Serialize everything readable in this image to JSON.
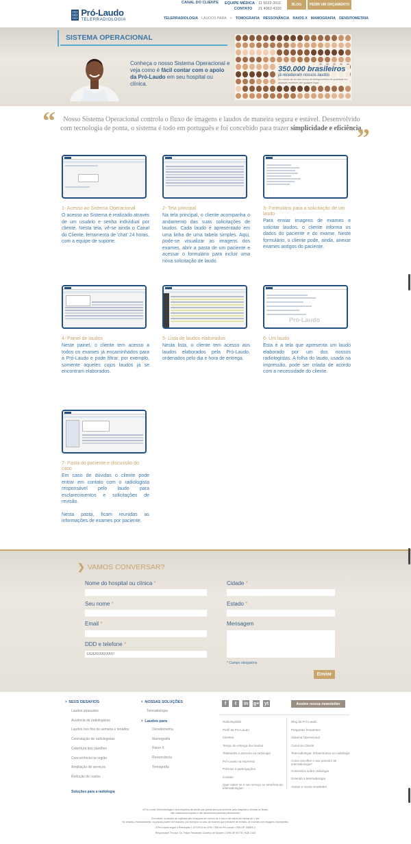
{
  "header": {
    "logo_name": "Pró-Laudo",
    "logo_sub": "TELERRADIOLOGIA",
    "canal_cliente": "CANAL DO CLIENTE",
    "equipe_medica": "EQUIPE MÉDICA",
    "contato": "CONTATO",
    "phone1": "11 5022-3011",
    "phone2": "21 4063 4100",
    "blog": "BLOG",
    "pedir_orcamento": "PEDIR UM ORÇAMENTO",
    "nav": [
      "TELERRADIOLOGIA",
      "LAUDOS PARA",
      "TOMOGRAFIA",
      "RESSONÂNCIA",
      "RAIOS X",
      "MAMOGRAFIA",
      "DENSITOMETRIA"
    ],
    "nav_sep": ">"
  },
  "banner": {
    "title": "SISTEMA OPERACIONAL",
    "text_pre": "Conheça o nosso Sistema Operacional e veja como é ",
    "text_bold": "fácil contar com o apoio da Pró-Laudo",
    "text_post": " em seu hospital ou clínica.",
    "ad_number": "350.000 brasileiros",
    "ad_sub": "já receberam nossos laudos",
    "ad_small": "Em menos de um ano fomos de entrega médica de qualidade em qualquer momento, em qualquer lugar."
  },
  "quote": {
    "text": "Nosso Sistema Operacional controla o fluxo de imagens e laudos de maneira segura e estável. Desenvolvido com tecnologia de ponta, o sistema é todo em português e foi concebido para trazer ",
    "bold": "simplicidade e eficiência",
    "end": "."
  },
  "steps": [
    {
      "title": "1- Acesso ao Sistema Operacional",
      "text": "O acesso ao Sistema é realizado através de um usuário e senha individual por cliente. Nesta tela, vê-se ainda o Canal do Cliente, ferramenta de 'chat' 24 horas, com a equipe de suporte."
    },
    {
      "title": "2- Tela principal",
      "text": "Na tela principal, o cliente acompanha o andamento das suas solicitações de laudos. Cada laudo é apresentado em uma linha de uma tabela simples. Aqui, pode-se visualizar as imagens dos exames, abrir a pasta de um paciente e acessar o formulário para incluir uma nova solicitação de laudo."
    },
    {
      "title": "3- Formulário para a solicitação de um laudo",
      "text": "Para enviar imagens de exames e solicitar laudos, o cliente informa os dados do paciente e do exame. Neste formulário, o cliente pode, ainda, anexar exames antigos do paciente."
    },
    {
      "title": "4- Painel de laudos",
      "text": "Neste painel, o cliente tem acesso a todos os exames já encaminhados para a Pró-Laudo e pode filtrar, por exemplo, somente aqueles cujos laudos já se encontram elaborados."
    },
    {
      "title": "5- Lista de laudos elaborados",
      "text": "Nesta lista, o cliente tem acesso aos laudos elaborados pela Pró-Laudo, ordenados pelo dia e hora de entrega."
    },
    {
      "title": "6- Um laudo",
      "text": "Esta é a tela que apresenta um laudo elaborado por um dos nossos radiologistas. A folha do laudo, usada na impressão, pode ser criada de acordo com a necessidade do cliente."
    },
    {
      "title": "7- Pasta do paciente e discussão do caso",
      "text": "Em caso de dúvidas o cliente pode entrar em contato com o radiologista responsável pelo laudo para esclarecimentos e solicitações de revisão.",
      "text2": "Nesta pasta, ficam reunidas as informações de exames por paciente."
    }
  ],
  "step6_watermark": "Pró-Laudo",
  "form": {
    "title": "VAMOS CONVERSAR?",
    "hospital": "Nome do hospital ou clínica",
    "seu_nome": "Seu nome",
    "email": "Email",
    "ddd": "DDD e telefone",
    "ddd_placeholder": "DDD00000000",
    "cidade": "Cidade",
    "estado": "Estado",
    "mensagem": "Mensagem",
    "required_mark": "*",
    "required_note": "* Campo obrigatório",
    "submit": "Enviar"
  },
  "footer": {
    "desafios_title": "SEUS DESAFIOS",
    "desafios": [
      "Laudos atrasados",
      "Ausência de radiologistas",
      "Laudos nos fins de semana e feriados",
      "Contratação de radiologistas",
      "Cobertura dos plantões",
      "Concorrência na região",
      "Ampliação de serviços",
      "Redução de custos"
    ],
    "solucoes_radiologia": "Soluções para a radiologia",
    "solucoes_title": "NOSSAS SOLUÇÕES",
    "solucoes_tele": "Teleradiologia",
    "laudos_para": "Laudos para",
    "solucoes": [
      "Densitometria",
      "Mamografia",
      "Raios-X",
      "Ressonância",
      "Tomografia"
    ],
    "social": [
      "f",
      "t",
      "in",
      "g+",
      "yt"
    ],
    "newsletter": "Assine nossa newsletter",
    "col3": [
      "Radiologistas",
      "Perfil da Pró-Laudo",
      "Clientes",
      "Tempo de entrega dos laudos",
      "Telelaudos e parceria na radiologia",
      "Pró-Laudo na imprensa",
      "Prêmios e participações",
      "Contato",
      "Quer saber se o seu serviço se beneficia da telerradiologia?"
    ],
    "col4": [
      "Blog da Pró-Laudo",
      "Perguntas frequentes",
      "Sistema Operacional",
      "Canal do Cliente",
      "Telerradiologia: Infraestrutura na radiologia",
      "Como escolher o seu parceiro de telerradiologia?",
      "Conteúdos sobre radiologia",
      "Entenda a telerradiologia",
      "Assine a nossa newsletter"
    ],
    "legal": [
      "A Pró-Laudo Telerradiologia é uma empresa de saúde que presta serviços somente para hospitais e clínicas no Brasil.",
      "Não realizamos exames e não atendemos pacientes diretamente.",
      "Em média, os laudos de urgência são entregues em menos de 1 hora e de rotina em menos de 1 dia.",
      "No entanto, eventualmente, os prazos podem ser maiores, por exemplo no caso de exames que precisem de revisão, de exames com imagens incompletas.",
      "A Pró-Laudo segue a Resolução 2.107/2014 do CFM. CRM do Pró-Laudo: CRM-SP 108805-2",
      "Responsável Técnico: Dr. Felipe Fernandes Cordeiro de Moraes | CRM-SP 90778 | RQE 2163"
    ]
  },
  "colors": {
    "accent": "#c7a56b",
    "brand": "#2b5b8c",
    "link": "#3a76a8"
  }
}
